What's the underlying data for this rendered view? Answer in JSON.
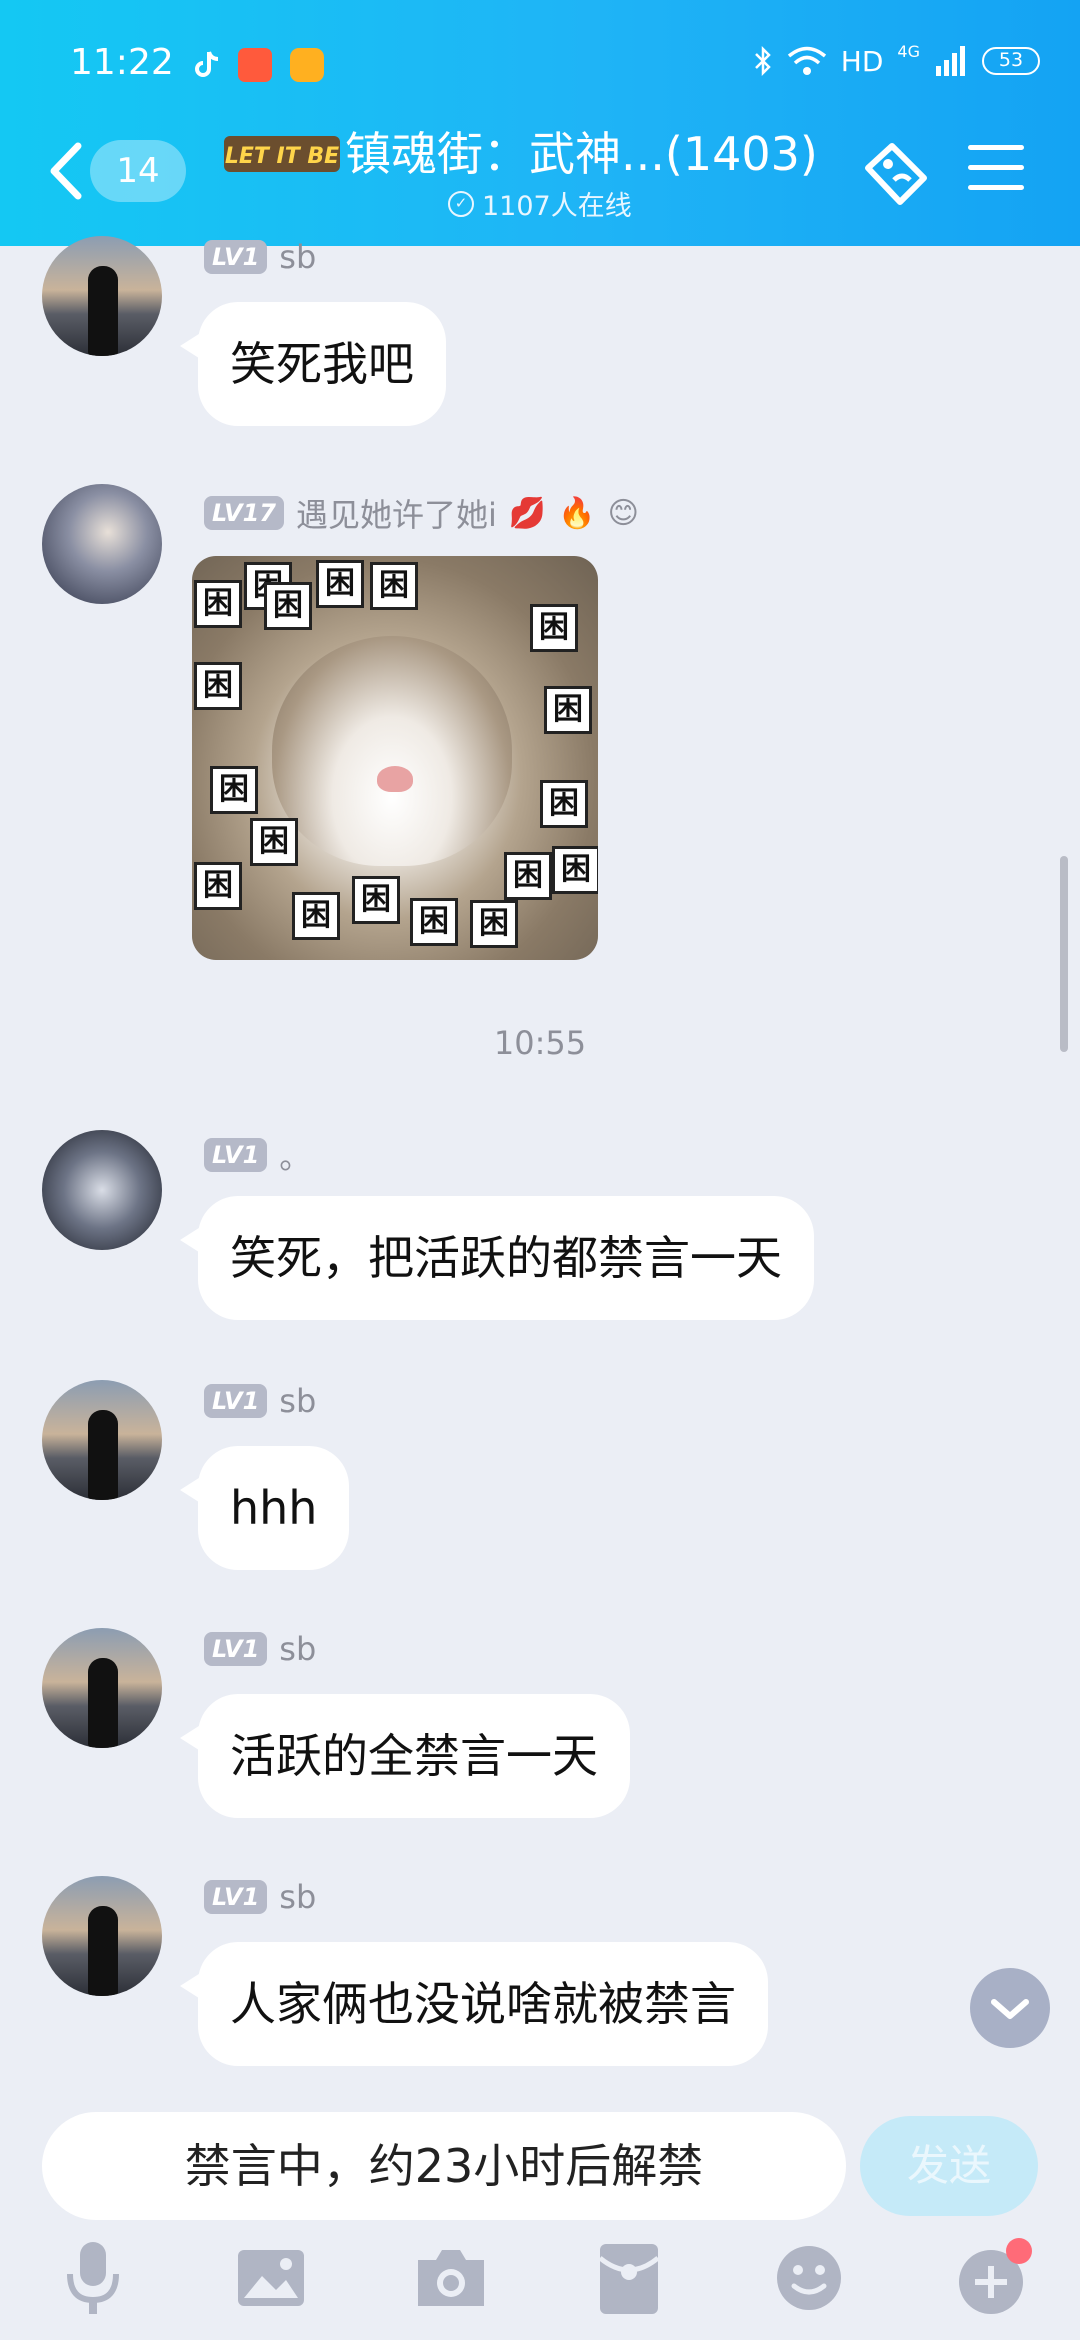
{
  "status_bar": {
    "time": "11:22",
    "network": "HD",
    "signal": "4G",
    "battery": "53"
  },
  "header": {
    "unread_count": "14",
    "logo_text": "LET IT BE",
    "title": "镇魂街：武神...(1403)",
    "online": "1107人在线"
  },
  "messages": [
    {
      "type": "text",
      "level": "LV1",
      "name": "sb",
      "text": "笑死我吧"
    },
    {
      "type": "image",
      "level": "LV17",
      "name": "遇见她许了她i",
      "badges": [
        "💋",
        "🔥",
        "😊"
      ],
      "image_text": "困"
    },
    {
      "type": "text",
      "level": "LV1",
      "name": "。",
      "text": "笑死，把活跃的都禁言一天"
    },
    {
      "type": "text",
      "level": "LV1",
      "name": "sb",
      "text": "hhh"
    },
    {
      "type": "text",
      "level": "LV1",
      "name": "sb",
      "text": "活跃的全禁言一天"
    },
    {
      "type": "text",
      "level": "LV1",
      "name": "sb",
      "text": "人家俩也没说啥就被禁言"
    }
  ],
  "timestamp": "10:55",
  "input": {
    "placeholder": "禁言中，约23小时后解禁",
    "send_label": "发送"
  },
  "toolbar": [
    "microphone-icon",
    "image-icon",
    "camera-icon",
    "red-packet-icon",
    "emoji-icon",
    "plus-icon"
  ],
  "colors": {
    "header_start": "#14c8f3",
    "header_end": "#14a3f3",
    "background": "#ebeef5",
    "bubble": "#ffffff",
    "level_badge": "#b5b9c8",
    "send_disabled": "#c5eaf8",
    "notify_dot": "#ff6b78"
  }
}
